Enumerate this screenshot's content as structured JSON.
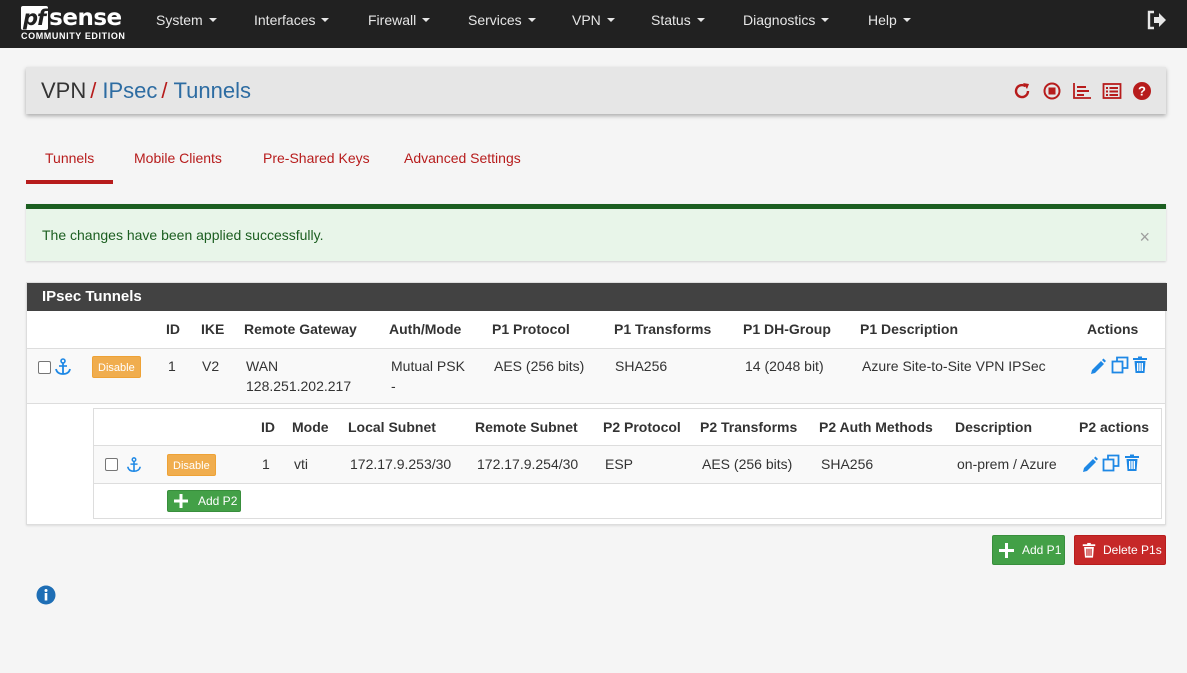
{
  "brand": {
    "logo_pf": "pf",
    "logo_sense": "sense",
    "edition": "COMMUNITY EDITION"
  },
  "nav": {
    "items": [
      {
        "label": "System"
      },
      {
        "label": "Interfaces"
      },
      {
        "label": "Firewall"
      },
      {
        "label": "Services"
      },
      {
        "label": "VPN"
      },
      {
        "label": "Status"
      },
      {
        "label": "Diagnostics"
      },
      {
        "label": "Help"
      }
    ],
    "logout_icon": "sign-out-icon"
  },
  "breadcrumb": {
    "root": "VPN",
    "middle": "IPsec",
    "current": "Tunnels",
    "separator": "/",
    "icons": [
      "restart-icon",
      "stop-icon",
      "chart-icon",
      "log-list-icon",
      "help-icon"
    ]
  },
  "tabs": [
    {
      "label": "Tunnels",
      "active": true
    },
    {
      "label": "Mobile Clients",
      "active": false
    },
    {
      "label": "Pre-Shared Keys",
      "active": false
    },
    {
      "label": "Advanced Settings",
      "active": false
    }
  ],
  "alert": {
    "message": "The changes have been applied successfully.",
    "close": "×"
  },
  "panel": {
    "title": "IPsec Tunnels",
    "p1_columns": {
      "id": "ID",
      "ike": "IKE",
      "remote_gateway": "Remote Gateway",
      "auth_mode": "Auth/Mode",
      "p1_protocol": "P1 Protocol",
      "p1_transforms": "P1 Transforms",
      "p1_dh_group": "P1 DH-Group",
      "p1_description": "P1 Description",
      "actions": "Actions"
    },
    "p1_rows": [
      {
        "disable_label": "Disable",
        "id": "1",
        "ike": "V2",
        "remote_gateway_line1": "WAN",
        "remote_gateway_line2": "128.251.202.217",
        "auth_mode_line1": "Mutual PSK",
        "auth_mode_line2": "-",
        "p1_protocol": "AES (256 bits)",
        "p1_transforms": "SHA256",
        "p1_dh_group": "14 (2048 bit)",
        "p1_description": "Azure Site-to-Site VPN IPSec"
      }
    ],
    "p2_columns": {
      "id": "ID",
      "mode": "Mode",
      "local_subnet": "Local Subnet",
      "remote_subnet": "Remote Subnet",
      "p2_protocol": "P2 Protocol",
      "p2_transforms": "P2 Transforms",
      "p2_auth_methods": "P2 Auth Methods",
      "description": "Description",
      "p2_actions": "P2 actions"
    },
    "p2_rows": [
      {
        "disable_label": "Disable",
        "id": "1",
        "mode": "vti",
        "local_subnet": "172.17.9.253/30",
        "remote_subnet": "172.17.9.254/30",
        "p2_protocol": "ESP",
        "p2_transforms": "AES (256 bits)",
        "p2_auth_methods": "SHA256",
        "description": "on-prem / Azure"
      }
    ],
    "add_p2_label": "Add P2"
  },
  "footer_buttons": {
    "add_p1": "Add P1",
    "delete_p1s": "Delete P1s"
  },
  "colors": {
    "navbar": "#212121",
    "accent_red": "#b71c1c",
    "link_blue": "#2d6ca2",
    "success_green": "#43a047",
    "warning_orange": "#f0ad4e",
    "danger_red": "#c62828",
    "icon_blue": "#1e88e5"
  }
}
